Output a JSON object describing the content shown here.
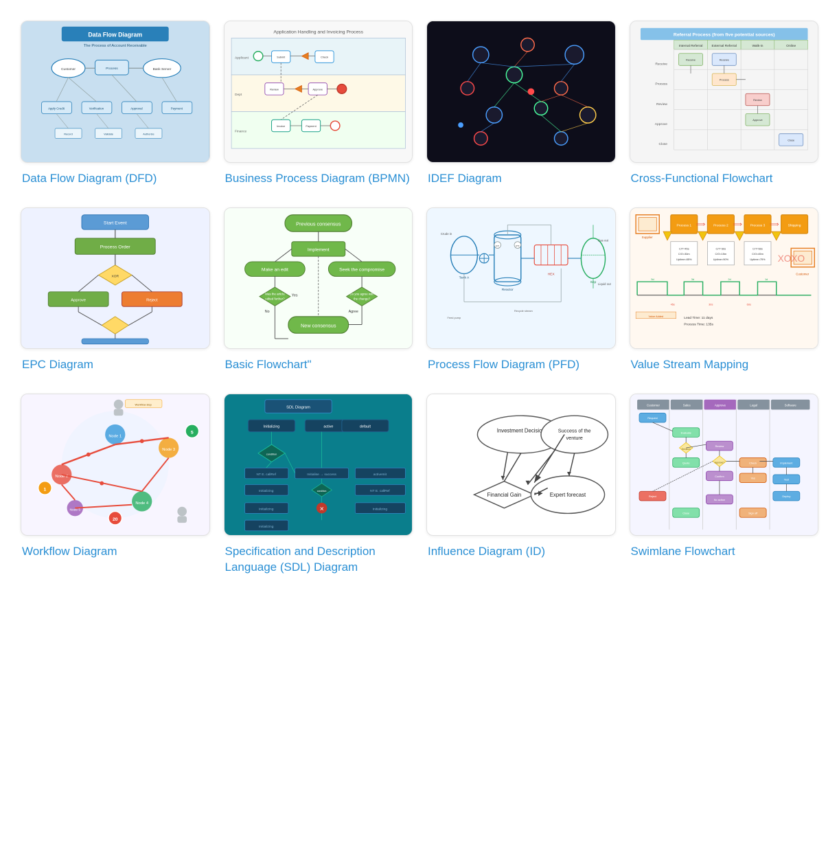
{
  "cards": [
    {
      "id": "dfd",
      "label": "Data Flow Diagram\n(DFD)",
      "label_line1": "Data Flow Diagram",
      "label_line2": "(DFD)",
      "thumb_class": "dfd-bg"
    },
    {
      "id": "bpmn",
      "label": "Business Process\nDiagram (BPMN)",
      "label_line1": "Business Process",
      "label_line2": "Diagram (BPMN)",
      "thumb_class": "bpmn-bg"
    },
    {
      "id": "idef",
      "label": "IDEF Diagram",
      "label_line1": "IDEF Diagram",
      "label_line2": "",
      "thumb_class": "idef-bg"
    },
    {
      "id": "cross",
      "label": "Cross-Functional\nFlowchart",
      "label_line1": "Cross-Functional",
      "label_line2": "Flowchart",
      "thumb_class": "cross-bg"
    },
    {
      "id": "epc",
      "label": "EPC Diagram",
      "label_line1": "EPC Diagram",
      "label_line2": "",
      "thumb_class": "epc-bg"
    },
    {
      "id": "flowchart",
      "label": "Basic Flowchart\"",
      "label_line1": "Basic Flowchart\"",
      "label_line2": "",
      "thumb_class": "flowchart-bg"
    },
    {
      "id": "pfd",
      "label": "Process Flow\nDiagram (PFD)",
      "label_line1": "Process Flow",
      "label_line2": "Diagram (PFD)",
      "thumb_class": "pfd-bg"
    },
    {
      "id": "vsm",
      "label": "Value Stream\nMapping",
      "label_line1": "Value Stream",
      "label_line2": "Mapping",
      "thumb_class": "vsm-bg"
    },
    {
      "id": "workflow",
      "label": "Workflow Diagram",
      "label_line1": "Workflow Diagram",
      "label_line2": "",
      "thumb_class": "workflow-bg"
    },
    {
      "id": "sdl",
      "label": "Specification and\nDescription Language\n(SDL) Diagram",
      "label_line1": "Specification and",
      "label_line2": "Description Language",
      "label_line3": "(SDL) Diagram",
      "thumb_class": "sdl-bg"
    },
    {
      "id": "influence",
      "label": "Influence Diagram\n(ID)",
      "label_line1": "Influence Diagram",
      "label_line2": "(ID)",
      "thumb_class": "influence-bg"
    },
    {
      "id": "swimlane",
      "label": "Swimlane Flowchart",
      "label_line1": "Swimlane Flowchart",
      "label_line2": "",
      "thumb_class": "swimlane-bg"
    }
  ]
}
